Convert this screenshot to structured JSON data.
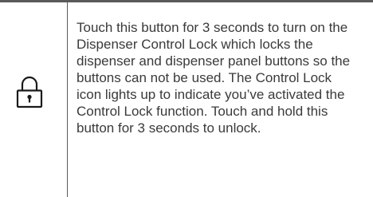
{
  "row": {
    "icon": "padlock-icon",
    "description": "Touch this button for 3 seconds to turn on the Dispenser Control Lock which locks the dispenser and dispenser panel buttons so the buttons can not be used. The Control Lock icon lights up to indicate you’ve activated the Control Lock function. Touch and hold this button for 3 seconds to unlock."
  },
  "colors": {
    "rule": "#5a5a5a",
    "text": "#3a3a3a",
    "icon": "#1a1a1a"
  }
}
